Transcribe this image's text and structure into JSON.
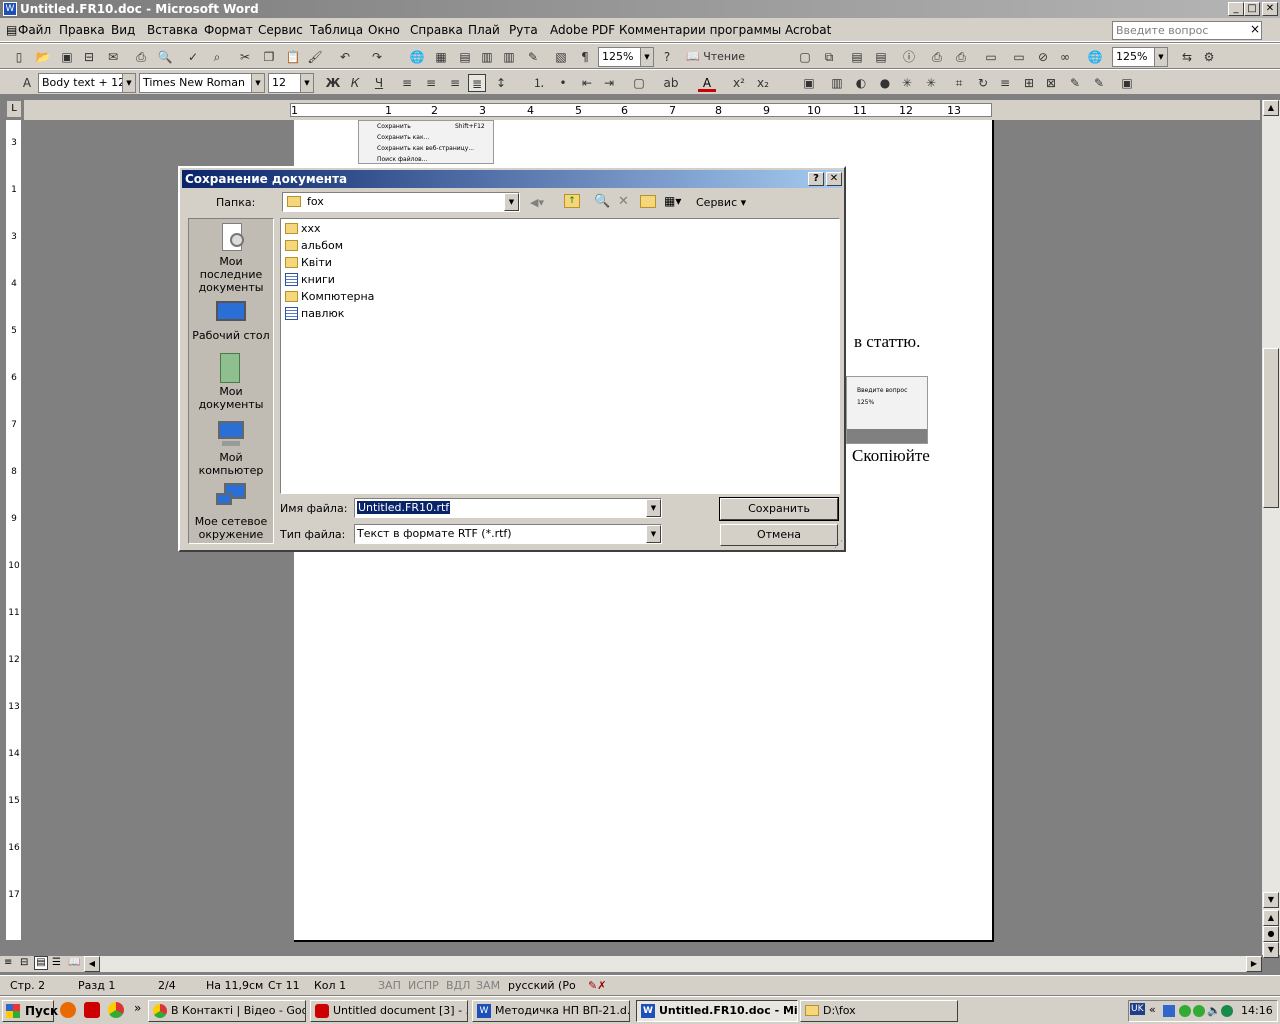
{
  "window": {
    "title": "Untitled.FR10.doc - Microsoft Word",
    "min": "_",
    "max": "□",
    "close": "✕"
  },
  "menu": {
    "items": [
      "Файл",
      "Правка",
      "Вид",
      "Вставка",
      "Формат",
      "Сервис",
      "Таблица",
      "Окно",
      "Справка",
      "Плай",
      "Рута",
      "Adobe PDF",
      "Комментарии программы Acrobat"
    ],
    "ask_placeholder": "Введите вопрос",
    "close_doc": "×"
  },
  "toolbar1": {
    "zoom": "125%",
    "reading": "Чтение",
    "zoom2": "125%"
  },
  "toolbar2": {
    "style": "Body text + 12 г",
    "font": "Times New Roman",
    "size": "12"
  },
  "ruler": {
    "numbers": [
      "1",
      "1",
      "2",
      "3",
      "4",
      "5",
      "6",
      "7",
      "8",
      "9",
      "10",
      "11",
      "12",
      "13"
    ]
  },
  "vruler": {
    "numbers": [
      "3",
      "2",
      "1",
      "1",
      "2",
      "3",
      "4",
      "5",
      "6",
      "7",
      "8",
      "9",
      "10",
      "11",
      "12",
      "13",
      "14",
      "15",
      "16",
      "17",
      "18"
    ]
  },
  "document": {
    "text1": "в   статтю.",
    "text2": "Скопіюйте",
    "thumb_menu": [
      "Сохранить",
      "Сохранить как...",
      "Сохранить как веб-страницу...",
      "Поиск файлов..."
    ],
    "thumb_menu_shortcut": "Shift+F12",
    "thumb_ask": "Введите вопрос",
    "thumb_zoom": "125%"
  },
  "dialog": {
    "title": "Сохранение документа",
    "help": "?",
    "close": "✕",
    "folder_label": "Папка:",
    "folder_value": "fox",
    "tools_label": "Сервис",
    "places": [
      {
        "label": "Мои последние документы",
        "icon": "recent-documents-icon"
      },
      {
        "label": "Рабочий стол",
        "icon": "desktop-icon"
      },
      {
        "label": "Мои документы",
        "icon": "my-documents-icon"
      },
      {
        "label": "Мой компьютер",
        "icon": "my-computer-icon"
      },
      {
        "label": "Мое сетевое окружение",
        "icon": "network-icon"
      }
    ],
    "files": [
      {
        "name": "xxx",
        "type": "folder"
      },
      {
        "name": "альбом",
        "type": "folder"
      },
      {
        "name": "Квіти",
        "type": "folder"
      },
      {
        "name": "книги",
        "type": "document"
      },
      {
        "name": "Компютерна",
        "type": "folder"
      },
      {
        "name": "павлюк",
        "type": "document"
      }
    ],
    "filename_label": "Имя файла:",
    "filename_value": "Untitled.FR10.rtf",
    "filetype_label": "Тип файла:",
    "filetype_value": "Текст в формате RTF (*.rtf)",
    "save_button": "Сохранить",
    "cancel_button": "Отмена"
  },
  "status": {
    "page": "Стр. 2",
    "section": "Разд 1",
    "pages": "2/4",
    "at": "На 11,9см",
    "line": "Ст 11",
    "col": "Кол 1",
    "rec": "ЗАП",
    "trk": "ИСПР",
    "ext": "ВДЛ",
    "ovr": "ЗАМ",
    "lang": "русский (Ро"
  },
  "taskbar": {
    "start": "Пуск",
    "chevron": "»",
    "tasks": [
      {
        "label": "В Контакті | Відео - Goo...",
        "active": false
      },
      {
        "label": "Untitled document [3] - ...",
        "active": false
      },
      {
        "label": "Методичка НП ВП-21.d...",
        "active": false
      },
      {
        "label": "Untitled.FR10.doc - Mi...",
        "active": true
      },
      {
        "label": "D:\\fox",
        "active": false
      }
    ],
    "lang": "UK",
    "tray_chevron": "«",
    "clock": "14:16"
  }
}
